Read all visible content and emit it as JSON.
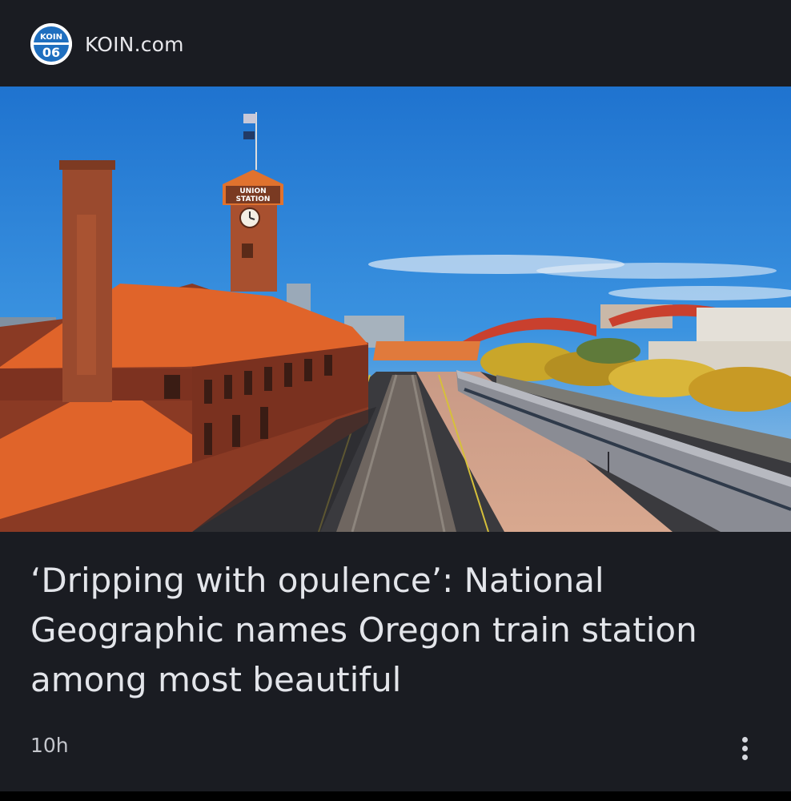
{
  "source": {
    "name": "KOIN.com",
    "logo_icon": "koin-6-logo",
    "logo_text_top": "KOIN",
    "logo_text_number": "06"
  },
  "hero_image": {
    "description_icon": "union-station-photo",
    "sign_line1": "UNION",
    "sign_line2": "STATION"
  },
  "article": {
    "headline": "‘Dripping with opulence’: National Geographic names Oregon train station among most beautiful",
    "age": "10h"
  },
  "actions": {
    "more_icon": "more-vertical-icon"
  },
  "colors": {
    "card_bg": "#1a1c22",
    "page_bg": "#000000",
    "headline": "#e3e5ea",
    "logo_blue": "#1f6fbf"
  }
}
